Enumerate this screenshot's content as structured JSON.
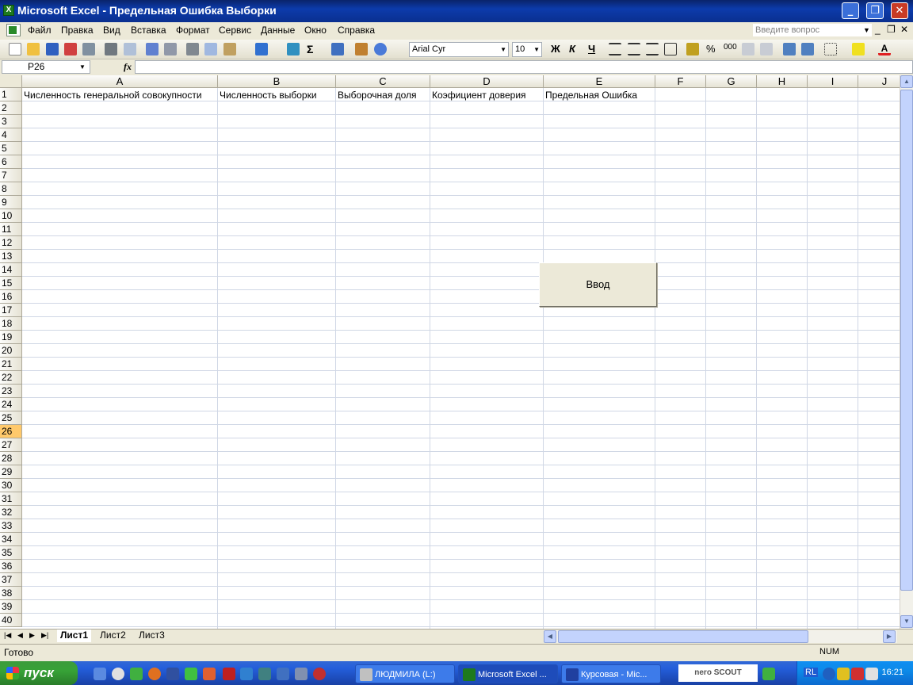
{
  "window": {
    "title": "Microsoft Excel - Предельная Ошибка Выборки",
    "minimize": "_",
    "restore": "❐",
    "close": "✕"
  },
  "menu": {
    "items": [
      "Файл",
      "Правка",
      "Вид",
      "Вставка",
      "Формат",
      "Сервис",
      "Данные",
      "Окно",
      "Справка"
    ],
    "ask_placeholder": "Введите вопрос"
  },
  "toolbar": {
    "font_name": "Arial Cyr",
    "font_size": "10",
    "bold": "Ж",
    "italic": "К",
    "underline": "Ч",
    "percent": "%",
    "thousands": "000",
    "sum": "Σ"
  },
  "formula_bar": {
    "name_box": "P26",
    "fx": "fx",
    "formula": ""
  },
  "columns": [
    "A",
    "B",
    "C",
    "D",
    "E",
    "F",
    "G",
    "H",
    "I",
    "J"
  ],
  "rows": [
    "1",
    "2",
    "3",
    "4",
    "5",
    "6",
    "7",
    "8",
    "9",
    "10",
    "11",
    "12",
    "13",
    "14",
    "15",
    "16",
    "17",
    "18",
    "19",
    "20",
    "21",
    "22",
    "23",
    "24",
    "25",
    "26",
    "27",
    "28",
    "29",
    "30",
    "31",
    "32",
    "33",
    "34",
    "35",
    "36",
    "37",
    "38",
    "39",
    "40"
  ],
  "active_row": "26",
  "row1": {
    "A": "Численность генеральной совокупности",
    "B": "Численность выборки",
    "C": "Выборочная доля",
    "D": "Коэфициент доверия",
    "E": "Предельная Ошибка"
  },
  "button_input": "Ввод",
  "sheets": [
    "Лист1",
    "Лист2",
    "Лист3"
  ],
  "active_sheet": "Лист1",
  "status": {
    "text": "Готово",
    "num": "NUM"
  },
  "taskbar": {
    "start": "пуск",
    "tasks": [
      "ЛЮДМИЛА (L:)",
      "Microsoft Excel ...",
      "Курсовая - Mic..."
    ],
    "nero": "nero SCOUT",
    "lang": "RL",
    "clock": "16:21"
  }
}
